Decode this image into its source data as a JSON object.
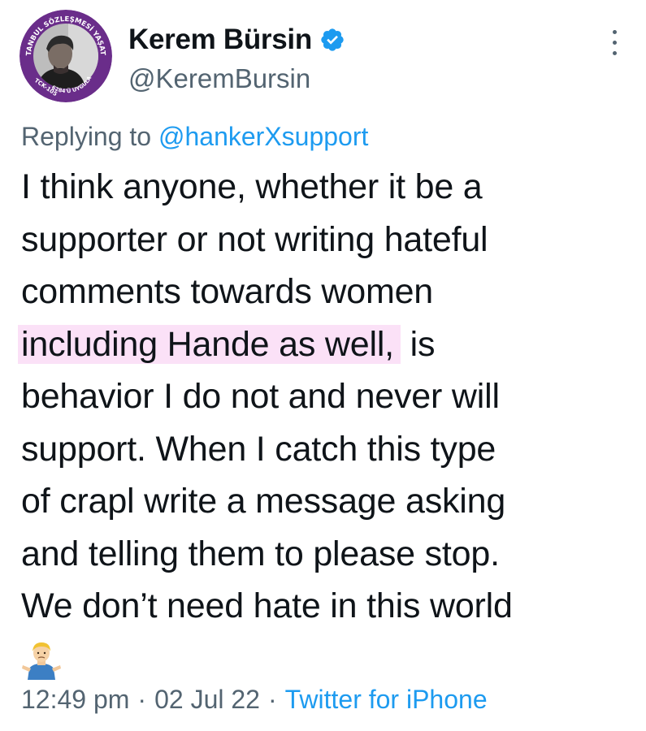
{
  "author": {
    "display_name": "Kerem Bürsin",
    "handle": "@KeremBursin",
    "verified_icon": "verified-badge-icon",
    "avatar_badge_text_top": "İSTANBUL SÖZLEŞMESİ YAŞATIR",
    "avatar_badge_text_bottom": "6284'Ü UYGULA",
    "avatar_badge_text_left": "TCK-105"
  },
  "reply": {
    "prefix": "Replying to ",
    "mention": "@hankerXsupport"
  },
  "tweet": {
    "lines": [
      "I think anyone, whether it be a",
      "supporter or not writing hateful",
      "comments towards women"
    ],
    "highlighted_text": "including Hande as well,",
    "after_highlight": " is",
    "lines_after": [
      "behavior I do not and never will",
      "support. When I catch this type",
      "of crapl write a message asking",
      "and telling them to please stop.",
      "We don’t need hate in this world"
    ],
    "emoji": "person-shrugging-emoji"
  },
  "meta": {
    "time": "12:49 pm",
    "separator": "·",
    "date": "02 Jul 22",
    "source": "Twitter for iPhone"
  },
  "colors": {
    "text": "#0f1419",
    "secondary": "#536471",
    "link": "#1d9bf0",
    "highlight": "#fbe1f7",
    "badge_purple": "#6a2d8a"
  }
}
